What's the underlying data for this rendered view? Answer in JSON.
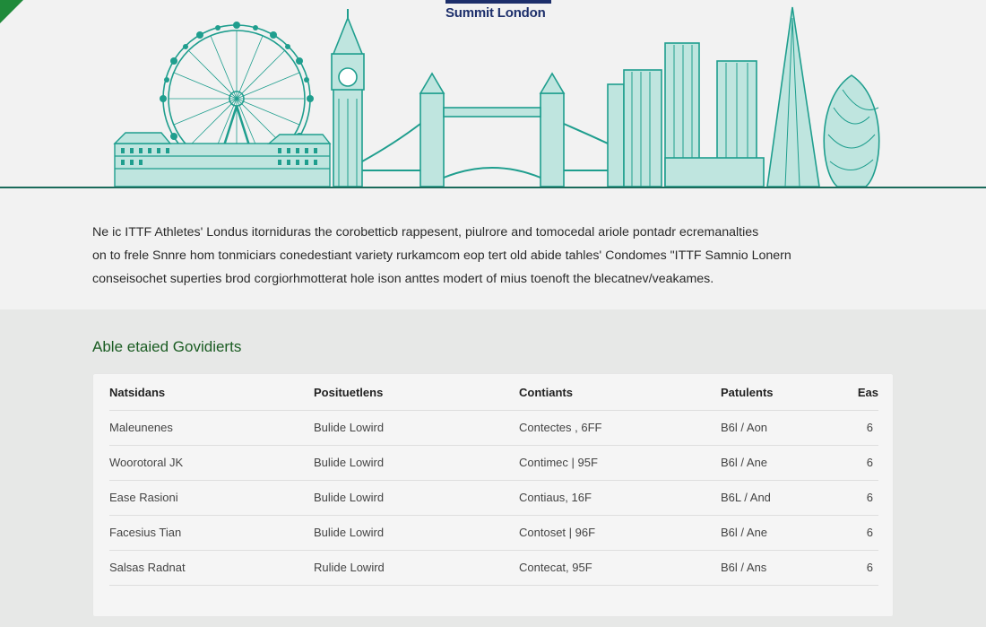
{
  "brand": {
    "name": "Summit London"
  },
  "intro": {
    "lines": [
      "Ne ic ITTF Athletes' Londus itorniduras the corobetticb rappesent, piulrore and tomocedal ariole pontadr ecremanalties",
      "on to frele Snnre hom tonmiciars conedestiant variety rurkamcom eop tert old abide tahles' Condomes \"ITTF Samnio Lonern",
      "conseisochet superties brod corgiorhmotterat hole ison anttes modert of mius toenoft the blecatnev/veakames."
    ]
  },
  "section": {
    "title": "Able etaied Govidierts"
  },
  "table": {
    "headers": [
      "Natsidans",
      "Posituetlens",
      "Contiants",
      "Patulents",
      "Eas"
    ],
    "rows": [
      [
        "Maleunenes",
        "Bulide Lowird",
        "Contectes , 6FF",
        "B6l / Aon",
        "6"
      ],
      [
        "Woorotoral JK",
        "Bulide Lowird",
        "Contimec | 95F",
        "B6l / Ane",
        "6"
      ],
      [
        "Ease Rasioni",
        "Bulide Lowird",
        "Contiaus, 16F",
        "B6L / And",
        "6"
      ],
      [
        "Facesius Tian",
        "Bulide Lowird",
        "Contoset | 96F",
        "B6l / Ane",
        "6"
      ],
      [
        "Salsas Radnat",
        "Rulide Lowird",
        "Contecat, 95F",
        "B6l / Ans",
        "6"
      ]
    ]
  },
  "colors": {
    "skyline": "#1f9e8e",
    "accent_green": "#1a5c22",
    "brand_navy": "#1d2f6b"
  }
}
